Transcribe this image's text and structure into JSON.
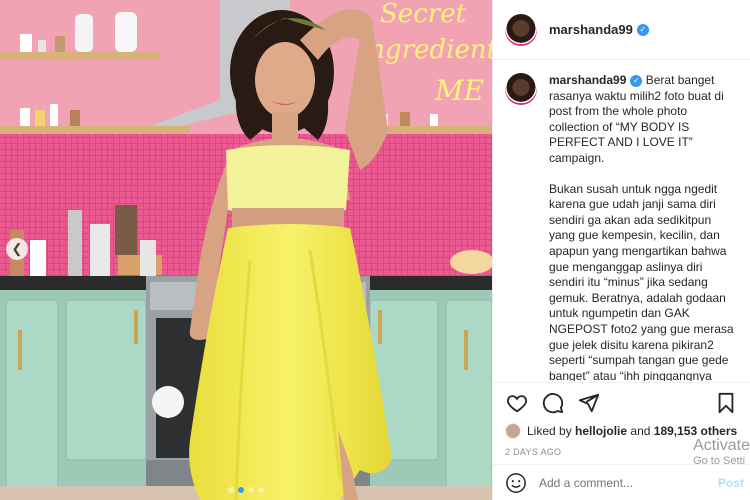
{
  "post": {
    "username": "marshanda99",
    "verified_icon": "verified-badge-icon",
    "caption_paragraphs": [
      "Berat banget rasanya waktu milih2 foto buat di post from the whole photo collection of “MY BODY IS PERFECT AND I LOVE IT” campaign.",
      "Bukan susah untuk ngga ngedit karena gue udah janji sama diri sendiri ga akan ada sedikitpun yang gue kempesin, kecilin, dan apapun yang mengartikan bahwa gue menganggap aslinya diri sendiri itu “minus” jika sedang gemuk. Beratnya, adalah godaan untuk ngumpetin dan GAK NGEPOST foto2 yang gue merasa gue jelek disitu karena pikiran2 seperti “sumpah tangan gue gede banget” atau “ihh pinggangnya lebar” atau “omg perutnya berlipet!!”"
    ],
    "likes": {
      "prefix": "Liked by",
      "first_liker": "hellojolie",
      "connector": "and",
      "others": "189,153 others"
    },
    "timestamp": "2 DAYS AGO",
    "comment_placeholder": "Add a comment...",
    "post_button": "Post"
  },
  "photo": {
    "neon_sign_text": [
      "Secret",
      "ingredient is",
      "ME"
    ],
    "carousel_dots": 4,
    "active_dot": 1
  },
  "watermark": {
    "line1": "Activate",
    "line2": "Go to Setti"
  },
  "colors": {
    "accent_blue": "#3897f0",
    "tile_pink": "#e2447e",
    "cabinet_mint": "#a9d8c4",
    "dress_yellow": "#f4ec58"
  }
}
